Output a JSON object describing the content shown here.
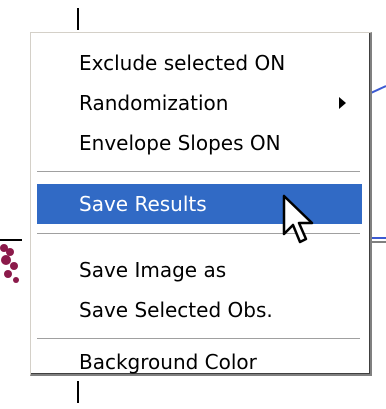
{
  "menu": {
    "items": [
      {
        "label": "Exclude selected ON"
      },
      {
        "label": "Randomization"
      },
      {
        "label": "Envelope Slopes ON"
      },
      {
        "label": "Save Results"
      },
      {
        "label": "Save Image as"
      },
      {
        "label": "Save Selected Obs."
      },
      {
        "label": "Background Color"
      }
    ],
    "highlighted_item": "Save Results",
    "highlight_color": "#316ac5",
    "submenu_item": "Randomization"
  },
  "icons": {
    "submenu": "submenu-arrow-icon",
    "pointer": "mouse-pointer-icon"
  },
  "colors": {
    "plot_points": "#8b1a4a",
    "plot_lines": "#3c5ad2"
  }
}
